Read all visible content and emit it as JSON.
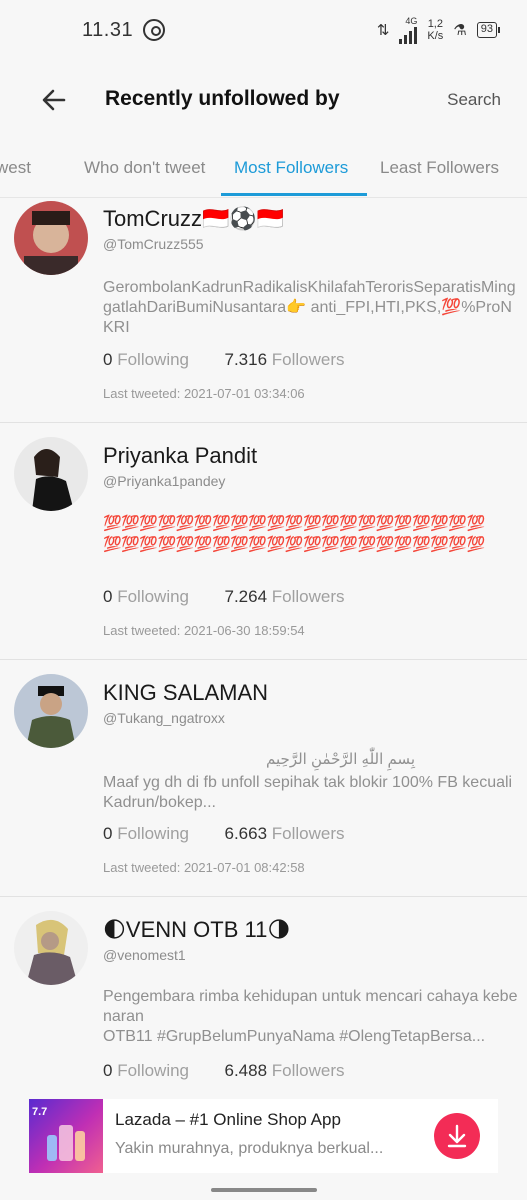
{
  "status": {
    "time": "11.31",
    "network": "4G",
    "speed": "1,2\nK/s",
    "battery": "93"
  },
  "header": {
    "title": "Recently unfollowed by",
    "search_label": "Search"
  },
  "tabs": [
    {
      "label": "west"
    },
    {
      "label": "Who don't tweet"
    },
    {
      "label": "Most Followers",
      "active": true
    },
    {
      "label": "Least Followers"
    }
  ],
  "labels": {
    "following": "Following",
    "followers": "Followers",
    "last_tweeted": "Last tweeted:"
  },
  "users": [
    {
      "name": "TomCruzz🇮🇩⚽🇮🇩",
      "handle": "@TomCruzz555",
      "bio": "GerombolanKadrunRadikalisKhilafahTerorisSeparatisMinggatlahDariBumiNusantara👉 anti_FPI,HTI,PKS,💯%ProNKRI",
      "following": "0",
      "followers": "7.316",
      "last_tweeted": "2021-07-01 03:34:06"
    },
    {
      "name": "Priyanka Pandit",
      "handle": "@Priyanka1pandey",
      "bio": "💯💯💯💯💯💯💯💯💯💯💯💯💯💯💯💯💯💯💯💯💯💯💯💯💯💯💯💯💯💯💯💯💯💯💯💯💯💯💯💯💯💯",
      "following": "0",
      "followers": "7.264",
      "last_tweeted": "2021-06-30 18:59:54"
    },
    {
      "name": "KING SALAMAN",
      "handle": "@Tukang_ngatroxx",
      "bio_arabic": "بِسمِ اللّٰهِ الرَّحْمٰنِ الرَّحِيم",
      "bio": "Maaf yg dh di fb unfoll sepihak tak blokir 100% FB kecuali Kadrun/bokep...",
      "following": "0",
      "followers": "6.663",
      "last_tweeted": "2021-07-01 08:42:58"
    },
    {
      "name": "🌓VENN OTB 11🌗",
      "handle": "@venomest1",
      "bio": "Pengembara rimba kehidupan untuk mencari cahaya kebenaran\nOTB11 #GrupBelumPunyaNama #OlengTetapBersa...",
      "following": "0",
      "followers": "6.488"
    }
  ],
  "ad": {
    "title": "Lazada – #1 Online Shop App",
    "subtitle": "Yakin murahnya, produknya berkual...",
    "thumb_text": "7.7"
  },
  "colors": {
    "accent": "#1d9bd8",
    "download": "#f32c56"
  }
}
